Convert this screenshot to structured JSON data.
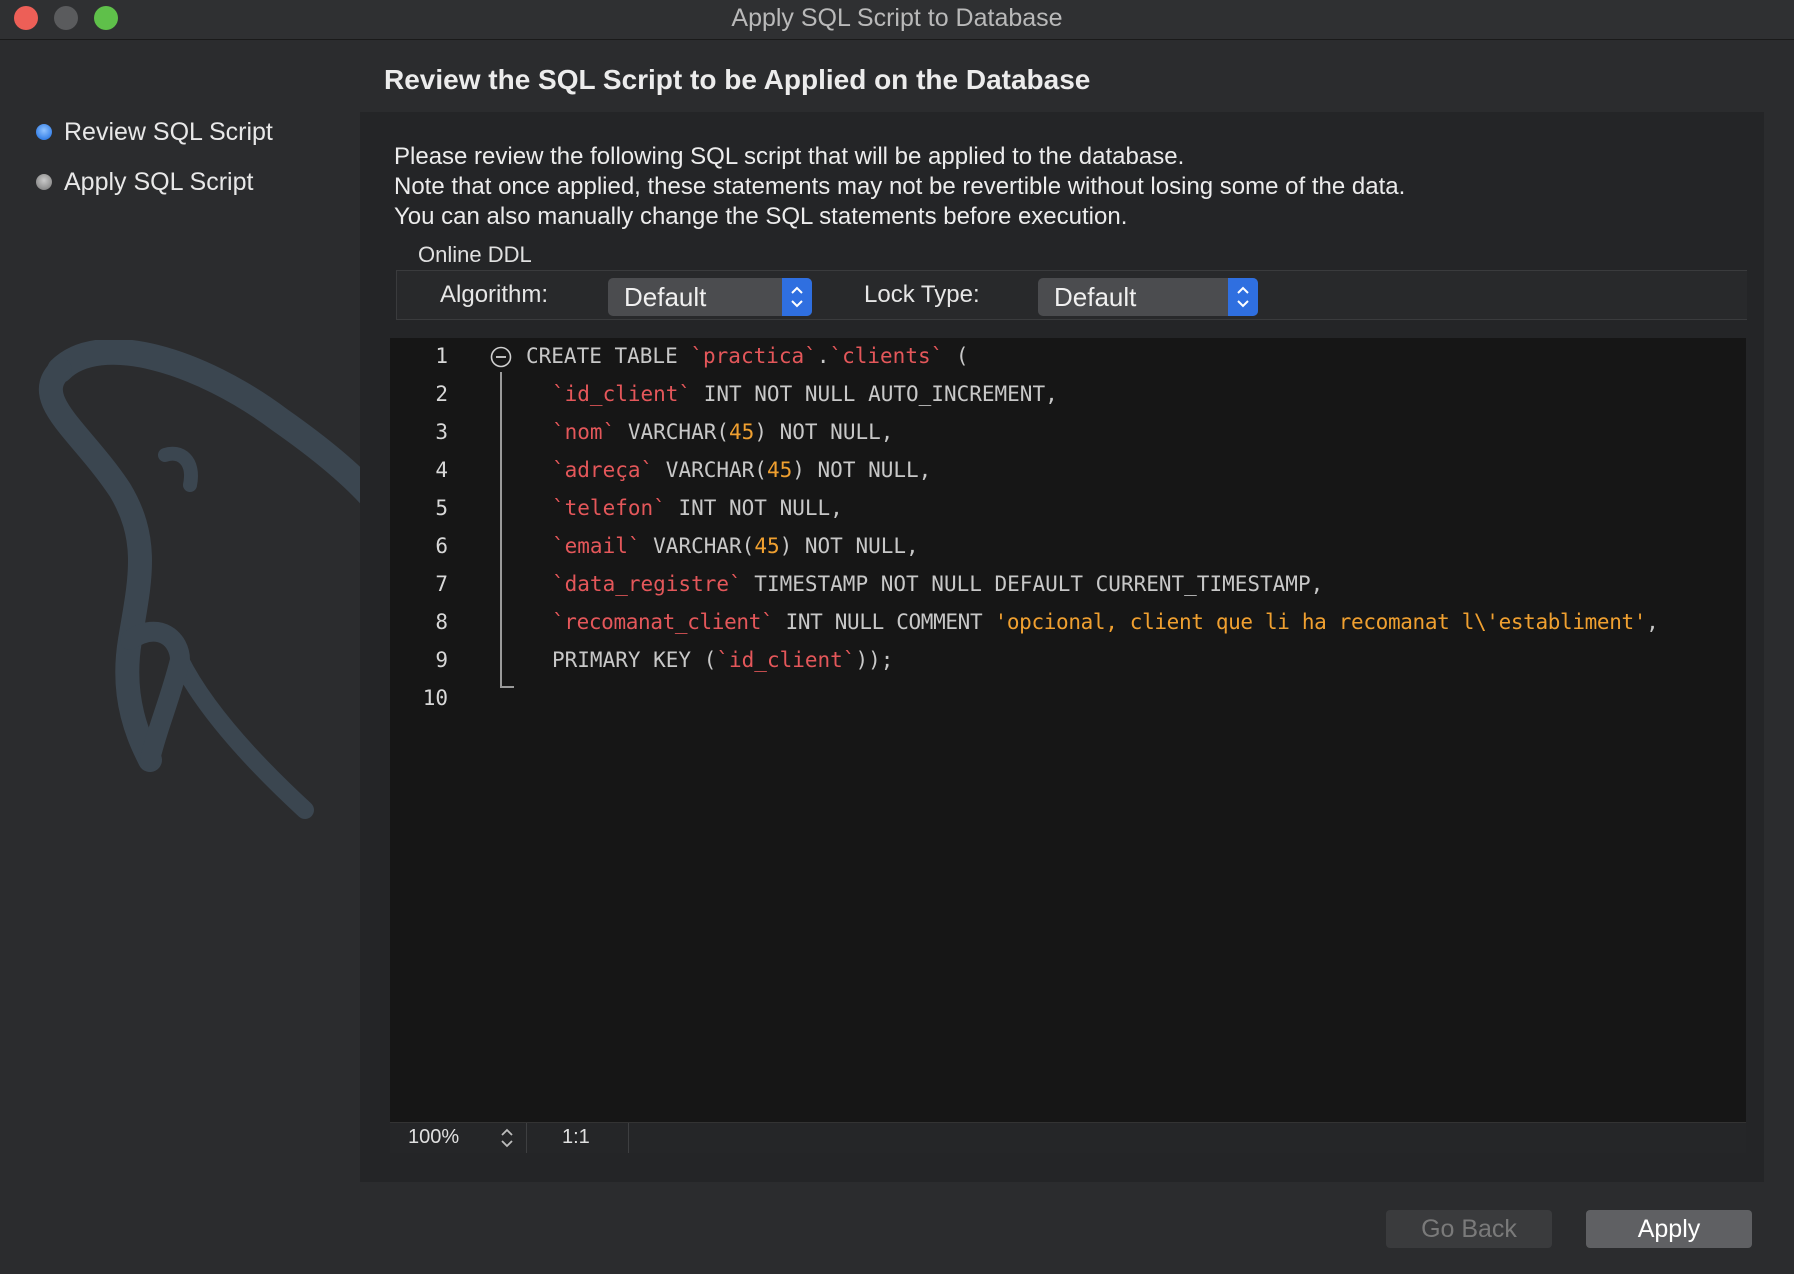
{
  "window": {
    "title": "Apply SQL Script to Database"
  },
  "steps": [
    {
      "label": "Review SQL Script",
      "active": true
    },
    {
      "label": "Apply SQL Script",
      "active": false
    }
  ],
  "heading": "Review the SQL Script to be Applied on the Database",
  "description": [
    "Please review the following SQL script that will be applied to the database.",
    "Note that once applied, these statements may not be revertible without losing some of the data.",
    "You can also manually change the SQL statements before execution."
  ],
  "online_ddl": {
    "label": "Online DDL",
    "algorithm_label": "Algorithm:",
    "algorithm_value": "Default",
    "lock_label": "Lock Type:",
    "lock_value": "Default"
  },
  "editor": {
    "line_numbers": [
      "1",
      "2",
      "3",
      "4",
      "5",
      "6",
      "7",
      "8",
      "9",
      "10"
    ],
    "code": {
      "l1_kw": "CREATE TABLE ",
      "l1_schema": "`practica`",
      "l1_dot": ".",
      "l1_table": "`clients`",
      "l1_paren": " (",
      "l2_id": "`id_client`",
      "l2_rest": " INT NOT NULL AUTO_INCREMENT,",
      "l3_id": "`nom`",
      "l3_type": " VARCHAR(",
      "l3_num": "45",
      "l3_rest": ") NOT NULL,",
      "l4_id": "`adreça`",
      "l4_type": " VARCHAR(",
      "l4_num": "45",
      "l4_rest": ") NOT NULL,",
      "l5_id": "`telefon`",
      "l5_rest": " INT NOT NULL,",
      "l6_id": "`email`",
      "l6_type": " VARCHAR(",
      "l6_num": "45",
      "l6_rest": ") NOT NULL,",
      "l7_id": "`data_registre`",
      "l7_rest": " TIMESTAMP NOT NULL DEFAULT CURRENT_TIMESTAMP,",
      "l8_id": "`recomanat_client`",
      "l8_rest": " INT NULL COMMENT ",
      "l8_str": "'opcional, client que li ha recomanat l\\'establiment'",
      "l8_end": ",",
      "l9_kw": "PRIMARY KEY (",
      "l9_id": "`id_client`",
      "l9_end": "));"
    }
  },
  "statusbar": {
    "zoom": "100%",
    "position": "1:1"
  },
  "buttons": {
    "back": "Go Back",
    "apply": "Apply"
  },
  "colors": {
    "identifier": "#e4575a",
    "number": "#f0a030",
    "string": "#f0a030",
    "accent": "#2f6fe0"
  }
}
